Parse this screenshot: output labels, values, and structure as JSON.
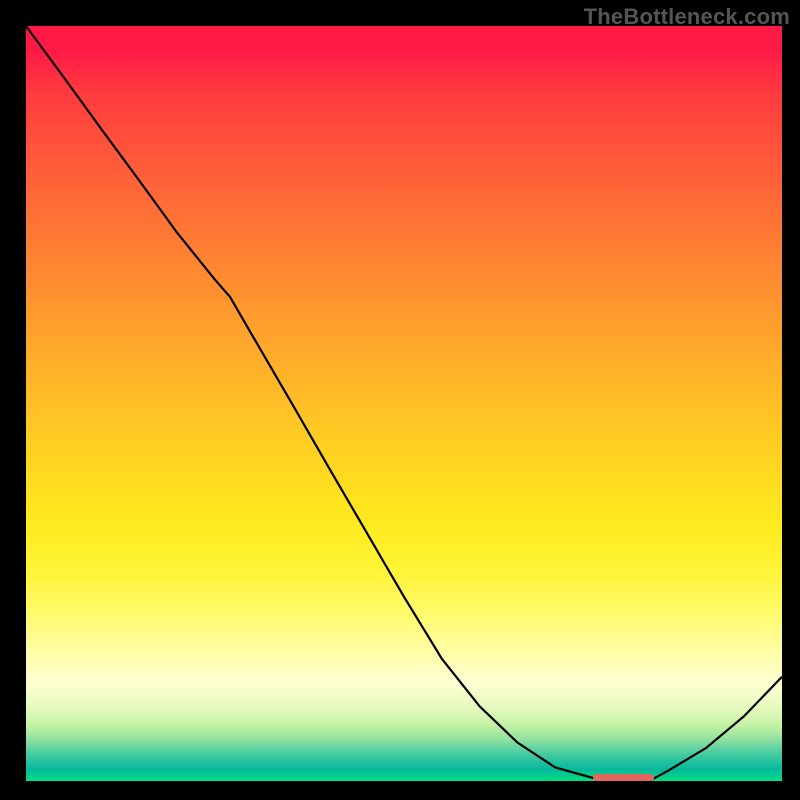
{
  "watermark_text": "TheBottleneck.com",
  "colors": {
    "line": "#000000",
    "watermark": "#555555",
    "marker": "#e2675e"
  },
  "chart_data": {
    "type": "line",
    "title": "",
    "xlabel": "",
    "ylabel": "",
    "x": [
      0,
      5,
      10,
      15,
      20,
      25,
      27,
      30,
      35,
      40,
      45,
      50,
      55,
      60,
      65,
      70,
      75,
      80,
      83,
      85,
      90,
      95,
      100
    ],
    "values": [
      100.0,
      93.2,
      86.3,
      79.5,
      72.6,
      66.4,
      64.1,
      58.9,
      50.3,
      41.6,
      33.0,
      24.4,
      16.2,
      9.9,
      5.1,
      1.8,
      0.4,
      0.0,
      0.3,
      1.4,
      4.4,
      8.6,
      13.8
    ],
    "xlim": [
      0,
      100
    ],
    "ylim": [
      0,
      100
    ],
    "series_name": "bottleneck-curve",
    "optimal_region": {
      "x_start": 75,
      "x_end": 83
    }
  }
}
